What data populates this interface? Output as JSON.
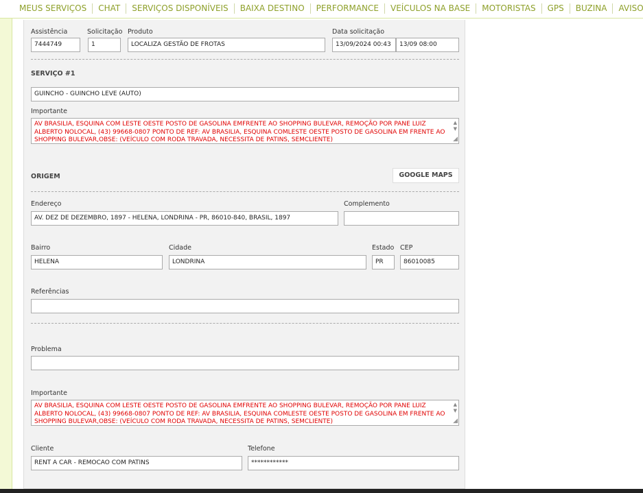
{
  "nav": {
    "items": [
      "MEUS SERVIÇOS",
      "CHAT",
      "SERVIÇOS DISPONÍVEIS",
      "BAIXA DESTINO",
      "PERFORMANCE",
      "VEÍCULOS NA BASE",
      "MOTORISTAS",
      "GPS",
      "BUZINA",
      "AVISOS"
    ]
  },
  "header": {
    "assistencia_label": "Assistência",
    "assistencia": "7444749",
    "solicitacao_label": "Solicitação",
    "solicitacao": "1",
    "produto_label": "Produto",
    "produto": "LOCALIZA GESTÃO DE FROTAS",
    "data_label": "Data solicitação",
    "data": "13/09/2024 00:43",
    "data2": "13/09 08:00"
  },
  "servico": {
    "title": "SERVIÇO #1",
    "tipo": "GUINCHO - GUINCHO LEVE (AUTO)",
    "importante_label": "Importante",
    "importante": "AV BRASILIA, ESQUINA COM LESTE OESTE POSTO DE GASOLINA EMFRENTE AO SHOPPING BULEVAR, REMOÇÃO POR PANE LUIZ ALBERTO NOLOCAL, (43) 99668-0807 PONTO DE REF: AV BRASILIA, ESQUINA COMLESTE OESTE POSTO DE GASOLINA EM FRENTE AO SHOPPING BULEVAR,OBSE: (VEÍCULO COM RODA TRAVADA, NECESSITA DE PATINS, SEMCLIENTE)"
  },
  "origem": {
    "title": "ORIGEM",
    "google_maps": "GOOGLE MAPS",
    "endereco_label": "Endereço",
    "endereco": "AV. DEZ DE DEZEMBRO, 1897 - HELENA, LONDRINA - PR, 86010-840, BRASIL, 1897",
    "complemento_label": "Complemento",
    "complemento": "",
    "bairro_label": "Bairro",
    "bairro": "HELENA",
    "cidade_label": "Cidade",
    "cidade": "LONDRINA",
    "estado_label": "Estado",
    "estado": "PR",
    "cep_label": "CEP",
    "cep": "86010085",
    "referencias_label": "Referências",
    "referencias": ""
  },
  "detalhes": {
    "problema_label": "Problema",
    "problema": "",
    "importante_label": "Importante",
    "importante": "AV BRASILIA, ESQUINA COM LESTE OESTE POSTO DE GASOLINA EMFRENTE AO SHOPPING BULEVAR, REMOÇÃO POR PANE LUIZ ALBERTO NOLOCAL, (43) 99668-0807 PONTO DE REF: AV BRASILIA, ESQUINA COMLESTE OESTE POSTO DE GASOLINA EM FRENTE AO SHOPPING BULEVAR,OBSE: (VEÍCULO COM RODA TRAVADA, NECESSITA DE PATINS, SEMCLIENTE)",
    "cliente_label": "Cliente",
    "cliente": "RENT A CAR - REMOCAO COM PATINS",
    "telefone_label": "Telefone",
    "telefone": "************"
  },
  "colors": {
    "nav_text": "#8ea02a",
    "important_text": "#e00000",
    "panel_bg": "#f2f2f2"
  }
}
